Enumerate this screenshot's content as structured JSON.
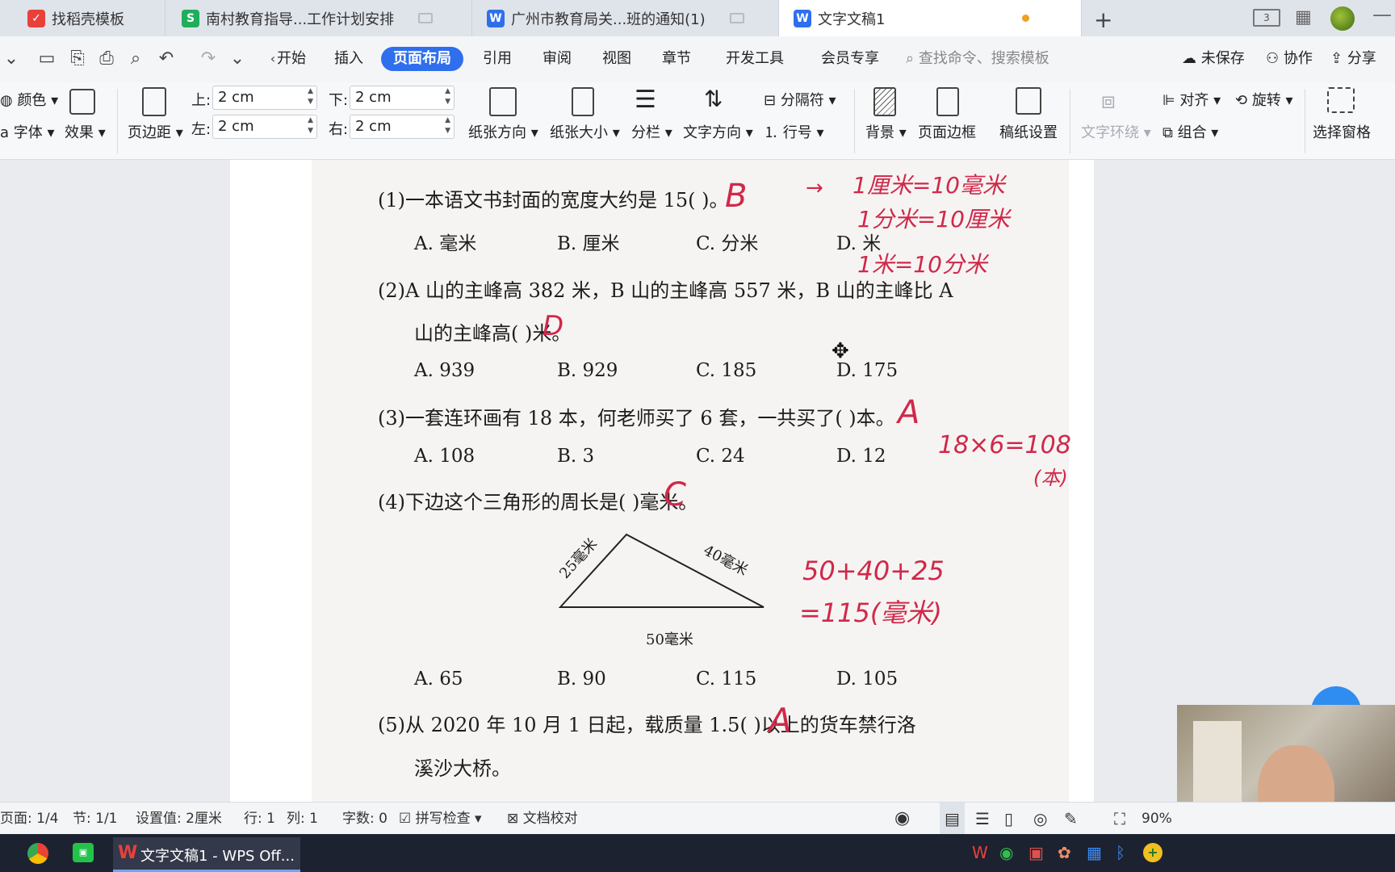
{
  "tabs": [
    {
      "label": "找稻壳模板",
      "icon": "docer-icon",
      "color": "#e8413a"
    },
    {
      "label": "南村教育指导...工作计划安排",
      "icon": "spreadsheet-icon",
      "color": "#1fae5b"
    },
    {
      "label": "广州市教育局关...班的通知(1)",
      "icon": "writer-doc-icon",
      "color": "#2f6fed"
    },
    {
      "label": "文字文稿1",
      "icon": "writer-doc-icon",
      "color": "#2f6fed"
    }
  ],
  "tabbar_right": {
    "badge": "3"
  },
  "menu": {
    "items": [
      "开始",
      "插入",
      "页面布局",
      "引用",
      "审阅",
      "视图",
      "章节",
      "开发工具",
      "会员专享"
    ],
    "active": "页面布局",
    "search_placeholder": "查找命令、搜索模板",
    "unsaved": "未保存",
    "collab": "协作",
    "share": "分享"
  },
  "ribbon": {
    "color": "颜色",
    "font": "a 字体",
    "effect": "效果",
    "margin": "页边距",
    "top_label": "上:",
    "top_value": "2 cm",
    "bottom_label": "下:",
    "bottom_value": "2 cm",
    "left_label": "左:",
    "left_value": "2 cm",
    "right_label": "右:",
    "right_value": "2 cm",
    "orientation": "纸张方向",
    "size": "纸张大小",
    "columns": "分栏",
    "text_direction": "文字方向",
    "separator": "分隔符",
    "line_number": "行号",
    "background": "背景",
    "page_border": "页面边框",
    "draft_paper": "稿纸设置",
    "text_wrap": "文字环绕",
    "align": "对齐",
    "rotate": "旋转",
    "group": "组合",
    "select_pane": "选择窗格"
  },
  "document": {
    "q1": "(1)一本语文书封面的宽度大约是 15(      )。",
    "q1_opts": [
      "A. 毫米",
      "B. 厘米",
      "C. 分米",
      "D. 米"
    ],
    "q2_line1": "(2)A 山的主峰高 382 米，B 山的主峰高 557 米，B 山的主峰比 A",
    "q2_line2": "山的主峰高(      )米。",
    "q2_opts": [
      "A. 939",
      "B. 929",
      "C. 185",
      "D. 175"
    ],
    "q3": "(3)一套连环画有 18 本，何老师买了 6 套，一共买了(      )本。",
    "q3_opts": [
      "A. 108",
      "B. 3",
      "C. 24",
      "D. 12"
    ],
    "q4": "(4)下边这个三角形的周长是(      )毫米。",
    "tri_left": "25毫米",
    "tri_right": "40毫米",
    "tri_bottom": "50毫米",
    "q4_opts": [
      "A. 65",
      "B. 90",
      "C. 115",
      "D. 105"
    ],
    "q5_line1": "(5)从 2020 年 10 月 1 日起，载质量 1.5(      )以上的货车禁行洛",
    "q5_line2": "溪沙大桥。",
    "handwriting": {
      "a1": "B",
      "a2": "D",
      "a3": "A",
      "a4": "C",
      "a5": "A",
      "note1": "1厘米=10毫米",
      "note2": "1分米=10厘米",
      "note3": "1米=10分米",
      "calc1": "18×6=108",
      "calc1_unit": "(本)",
      "calc2": "50+40+25",
      "calc3": "=115(毫米)"
    }
  },
  "status": {
    "page": "页面: 1/4",
    "section": "节: 1/1",
    "setting": "设置值: 2厘米",
    "row": "行: 1",
    "col": "列: 1",
    "words": "字数: 0",
    "spell": "拼写检查",
    "proof": "文档校对",
    "zoom": "90%"
  },
  "taskbar": {
    "app": "文字文稿1 - WPS Off..."
  },
  "colors": {
    "accent": "#2f6fed",
    "ink": "#d0284a",
    "taskbar": "#1d2230"
  }
}
